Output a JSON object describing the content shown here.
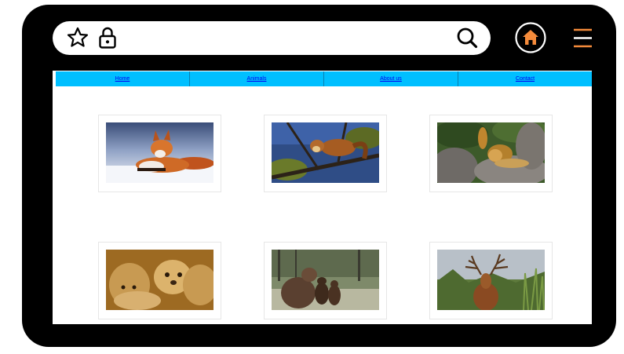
{
  "nav": {
    "items": [
      {
        "label": "Home"
      },
      {
        "label": "Animals"
      },
      {
        "label": "About us"
      },
      {
        "label": "Contact"
      }
    ]
  },
  "icons": {
    "favorite": "star-icon",
    "secure": "lock-icon",
    "search": "search-icon",
    "home": "home-icon",
    "menu": "hamburger-menu-icon"
  },
  "colors": {
    "device_frame": "#000000",
    "accent_orange": "#f58b3b",
    "nav_background": "#00bfff",
    "link": "#0000ee"
  },
  "gallery": {
    "images": [
      {
        "subject": "red fox in snow"
      },
      {
        "subject": "pine marten on branch"
      },
      {
        "subject": "lions on rocks"
      },
      {
        "subject": "cheetah cubs"
      },
      {
        "subject": "brown bears in meadow"
      },
      {
        "subject": "red deer stag"
      }
    ]
  }
}
